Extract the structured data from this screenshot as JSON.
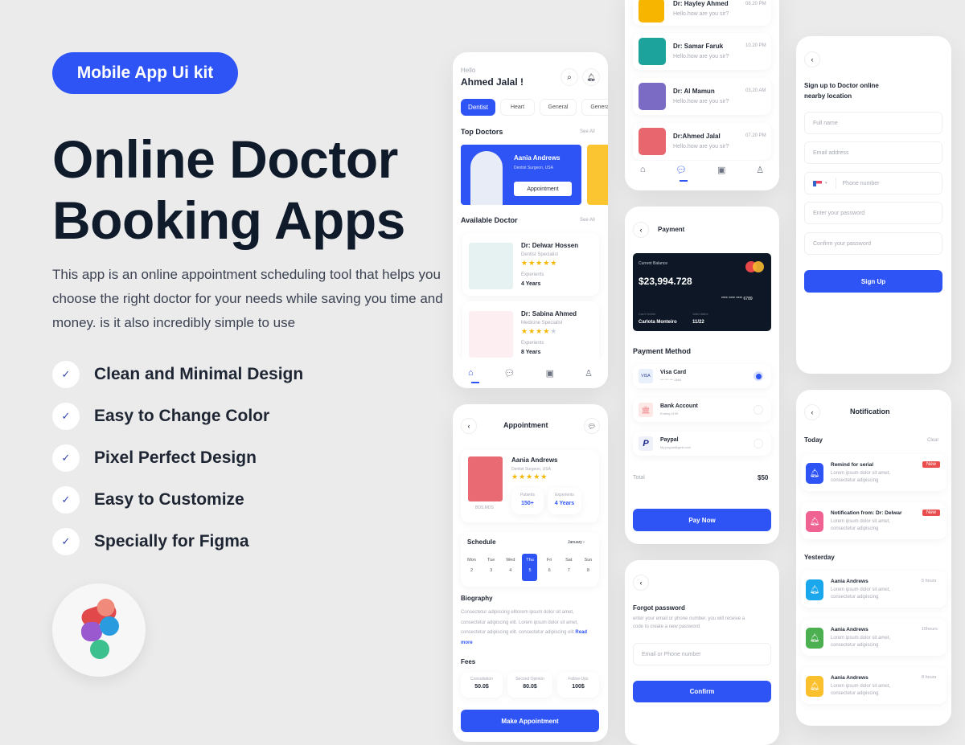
{
  "hero": {
    "badge": "Mobile App Ui kit",
    "title_line1": "Online Doctor",
    "title_line2": "Booking Apps",
    "description": "This app is an online appointment scheduling tool that helps you choose the right doctor for your needs while saving you time and money. is it also incredibly simple to use",
    "features": [
      "Clean and Minimal Design",
      "Easy to Change Color",
      "Pixel Perfect Design",
      "Easy to Customize",
      "Specially for Figma"
    ],
    "check_icon": "✓",
    "accent": "#2f54f5"
  },
  "home": {
    "greeting": "Hello",
    "user_name": "Ahmed Jalal !",
    "categories": [
      "Dentist",
      "Heart",
      "General",
      "Genera"
    ],
    "top_doctors_title": "Top Doctors",
    "see_all": "See All",
    "featured": {
      "name": "Aania Andrews",
      "role": "Dentist Surgeon, USA",
      "button": "Appointment"
    },
    "available_title": "Available Doctor",
    "doctors": [
      {
        "name": "Dr: Delwar Hossen",
        "specialty": "Dentist Specialist",
        "rating": 5,
        "exp_label": "Experients",
        "exp": "4 Years"
      },
      {
        "name": "Dr: Sabina  Ahmed",
        "specialty": "Medicine Specialist",
        "rating": 4,
        "exp_label": "Experients",
        "exp": "8 Years"
      }
    ]
  },
  "chat": {
    "items": [
      {
        "name": "Dr: Hayley Ahmed",
        "msg": "Hello.how are you sir?",
        "time": "08.20 PM",
        "color": "#f7b500"
      },
      {
        "name": "Dr: Samar Faruk",
        "msg": "Hello.how are you sir?",
        "time": "10.20 PM",
        "color": "#1ba39c"
      },
      {
        "name": "Dr: Al Mamun",
        "msg": "Hello.how are you sir?",
        "time": "03.20 AM",
        "color": "#7c6bc4"
      },
      {
        "name": "Dr:Ahmed Jalal",
        "msg": "Hello.how are you sir?",
        "time": "07.20 PM",
        "color": "#e8676f"
      }
    ]
  },
  "payment": {
    "title": "Payment",
    "card": {
      "balance_label": "Current Balance",
      "balance": "$23,994.728",
      "number": "**** **** **** 6789",
      "holder_label": "Card Holder",
      "holder": "Carlota Monteiro",
      "valid_label": "Valid dates",
      "valid": "11/22"
    },
    "method_title": "Payment Method",
    "methods": [
      {
        "name": "Visa Card",
        "detail": "*** *** *** 2684",
        "selected": true
      },
      {
        "name": "Bank Account",
        "detail": "Ending 1199",
        "selected": false
      },
      {
        "name": "Paypal",
        "detail": "My.paypal@gmil.com",
        "selected": false
      }
    ],
    "total_label": "Total",
    "total": "$50",
    "button": "Pay Now"
  },
  "forgot": {
    "title": "Forgot password",
    "subtitle": "enter your email or phone number. you will receive a code to create a new password",
    "placeholder": "Email or Phone number",
    "button": "Confirm"
  },
  "signup": {
    "title": "Sign up to Doctor online nearby location",
    "fields": [
      "Full name",
      "Email address",
      "Phone number",
      "Enter your password",
      "Confirm your password"
    ],
    "button": "Sign Up"
  },
  "appointment": {
    "title": "Appointment",
    "doctor": {
      "name": "Aania Andrews",
      "role": "Dentist Surgeon, USA",
      "degree": "BDS,MDS",
      "patients_label": "Patients",
      "patients": "150+",
      "exp_label": "Experients",
      "exp": "4 Years",
      "rating": 5
    },
    "schedule_title": "Schedule",
    "month": "January",
    "days": [
      {
        "d": "Mon",
        "n": "2"
      },
      {
        "d": "Tue",
        "n": "3"
      },
      {
        "d": "Wed",
        "n": "4"
      },
      {
        "d": "Thu",
        "n": "5",
        "active": true
      },
      {
        "d": "Fri",
        "n": "6"
      },
      {
        "d": "Sat",
        "n": "7"
      },
      {
        "d": "Sun",
        "n": "8"
      }
    ],
    "bio_title": "Biography",
    "bio": "Consectetur adipiscing elitorem ipsum dolor sit amet, consectetur adipiscing elit. Lorem ipsum dolor sit amet, consectetur adipiscing elit. consectetur adipiscing elit",
    "read_more": "Read more",
    "fees_title": "Fees",
    "fees": [
      {
        "label": "Consultation",
        "value": "50.0$"
      },
      {
        "label": "Second Opinion",
        "value": "80.0$"
      },
      {
        "label": "Follow-Ups",
        "value": "100$"
      }
    ],
    "button": "Make Appointment"
  },
  "notifications": {
    "title": "Notification",
    "today": "Today",
    "clear": "Clear",
    "yesterday": "Yesterday",
    "today_items": [
      {
        "title": "Remind for serial",
        "body": "Lorem ipsum dolor sit amet, consectetur adipiscing",
        "badge": "New",
        "color": "#2f54f5"
      },
      {
        "title": "Notification from: Dr: Delwar",
        "body": "Lorem ipsum dolor sit amet, consectetur adipiscing",
        "badge": "New",
        "color": "#f06292"
      }
    ],
    "yesterday_items": [
      {
        "title": "Aania Andrews",
        "body": "Lorem ipsum dolor sit amet, consectetur adipiscing",
        "time": "5 hours",
        "color": "#1aa7ec"
      },
      {
        "title": "Aania Andrews",
        "body": "Lorem ipsum dolor sit amet, consectetur adipiscing",
        "time": "10hours",
        "color": "#4caf50"
      },
      {
        "title": "Aania Andrews",
        "body": "Lorem ipsum dolor sit amet, consectetur adipiscing",
        "time": "8 hours",
        "color": "#fbc02d"
      }
    ]
  }
}
